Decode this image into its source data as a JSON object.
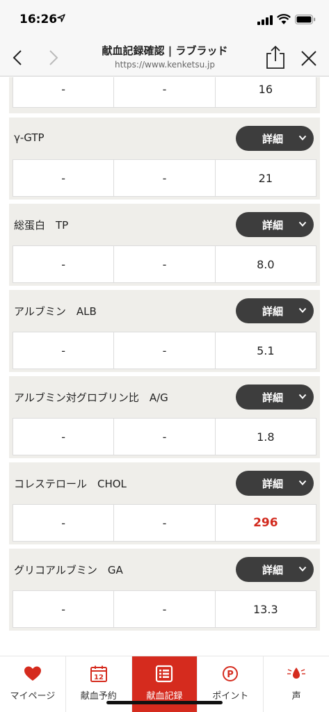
{
  "status_bar": {
    "time": "16:26"
  },
  "browser": {
    "title": "献血記録確認 | ラブラッド",
    "url": "https://www.kenketsu.jp"
  },
  "top_partial": {
    "values": [
      "-",
      "-",
      "16"
    ]
  },
  "tests": [
    {
      "name": "γ-GTP",
      "button": "詳細",
      "values": [
        "-",
        "-",
        "21"
      ],
      "highlight": false
    },
    {
      "name": "総蛋白　TP",
      "button": "詳細",
      "values": [
        "-",
        "-",
        "8.0"
      ],
      "highlight": false
    },
    {
      "name": "アルブミン　ALB",
      "button": "詳細",
      "values": [
        "-",
        "-",
        "5.1"
      ],
      "highlight": false
    },
    {
      "name": "アルブミン対グロブリン比　A/G",
      "button": "詳細",
      "values": [
        "-",
        "-",
        "1.8"
      ],
      "highlight": false
    },
    {
      "name": "コレステロール　CHOL",
      "button": "詳細",
      "values": [
        "-",
        "-",
        "296"
      ],
      "highlight": true
    },
    {
      "name": "グリコアルブミン　GA",
      "button": "詳細",
      "values": [
        "-",
        "-",
        "13.3"
      ],
      "highlight": false
    }
  ],
  "tabbar": {
    "items": [
      {
        "label": "マイページ",
        "icon": "heart-icon"
      },
      {
        "label": "献血予約",
        "icon": "calendar-icon",
        "icon_text": "12"
      },
      {
        "label": "献血記録",
        "icon": "list-icon",
        "active": true
      },
      {
        "label": "ポイント",
        "icon": "point-icon",
        "icon_text": "P"
      },
      {
        "label": "声",
        "icon": "blood-drop-icon"
      }
    ]
  },
  "colors": {
    "accent": "#d52b1e",
    "button_dark": "#3d3d3d",
    "card_bg": "#efeeea"
  }
}
